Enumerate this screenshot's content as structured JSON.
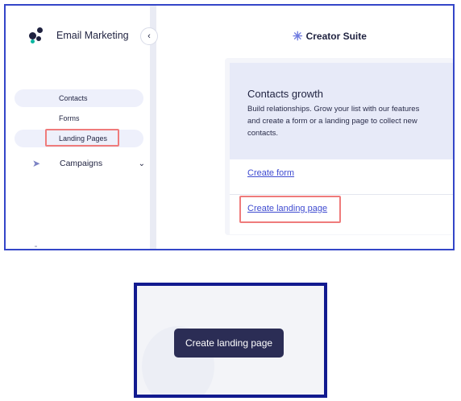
{
  "sidebar": {
    "brand_name": "Email Marketing",
    "collapse_icon": "chevron-left",
    "items": [
      {
        "label": "Contacts"
      },
      {
        "label": "Forms"
      },
      {
        "label": "Landing Pages"
      },
      {
        "label": "Campaigns",
        "icon": "send-icon"
      }
    ]
  },
  "header": {
    "suite_name": "Creator Suite"
  },
  "card": {
    "title": "Contacts growth",
    "description": "Build relationships. Grow your list with our features and create a form or a landing page to collect new contacts.",
    "links": [
      {
        "label": "Create form"
      },
      {
        "label": "Create landing page"
      }
    ]
  },
  "zoom": {
    "button_label": "Create landing page"
  },
  "colors": {
    "highlight": "#ef7b7b",
    "frame_top": "#3446c8",
    "frame_bottom": "#121a8f",
    "button_bg": "#2b2d55",
    "link": "#3f4bd0"
  }
}
